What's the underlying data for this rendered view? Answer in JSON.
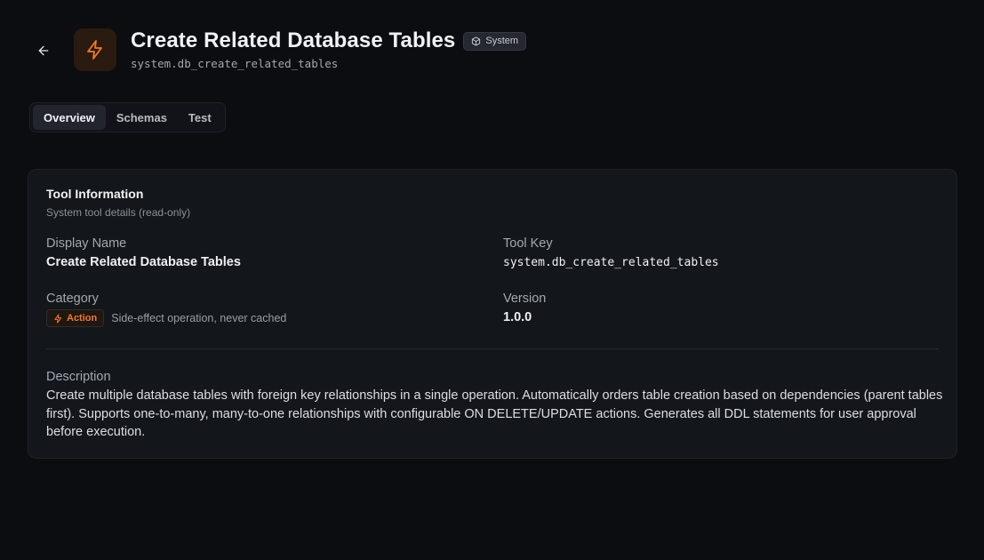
{
  "header": {
    "title": "Create Related Database Tables",
    "badge": "System",
    "tool_key": "system.db_create_related_tables",
    "back_icon": "arrow-left-icon",
    "tool_icon": "lightning-icon",
    "accent": "#f07a2a"
  },
  "tabs": [
    {
      "label": "Overview",
      "active": true
    },
    {
      "label": "Schemas",
      "active": false
    },
    {
      "label": "Test",
      "active": false
    }
  ],
  "card": {
    "title": "Tool Information",
    "subtitle": "System tool details (read-only)",
    "display_name_label": "Display Name",
    "display_name": "Create Related Database Tables",
    "tool_key_label": "Tool Key",
    "tool_key": "system.db_create_related_tables",
    "category_label": "Category",
    "category_badge": "Action",
    "category_desc": "Side-effect operation, never cached",
    "version_label": "Version",
    "version": "1.0.0",
    "description_label": "Description",
    "description": "Create multiple database tables with foreign key relationships in a single operation. Automatically orders table creation based on dependencies (parent tables first). Supports one-to-many, many-to-one relationships with configurable ON DELETE/UPDATE actions. Generates all DDL statements for user approval before execution."
  }
}
